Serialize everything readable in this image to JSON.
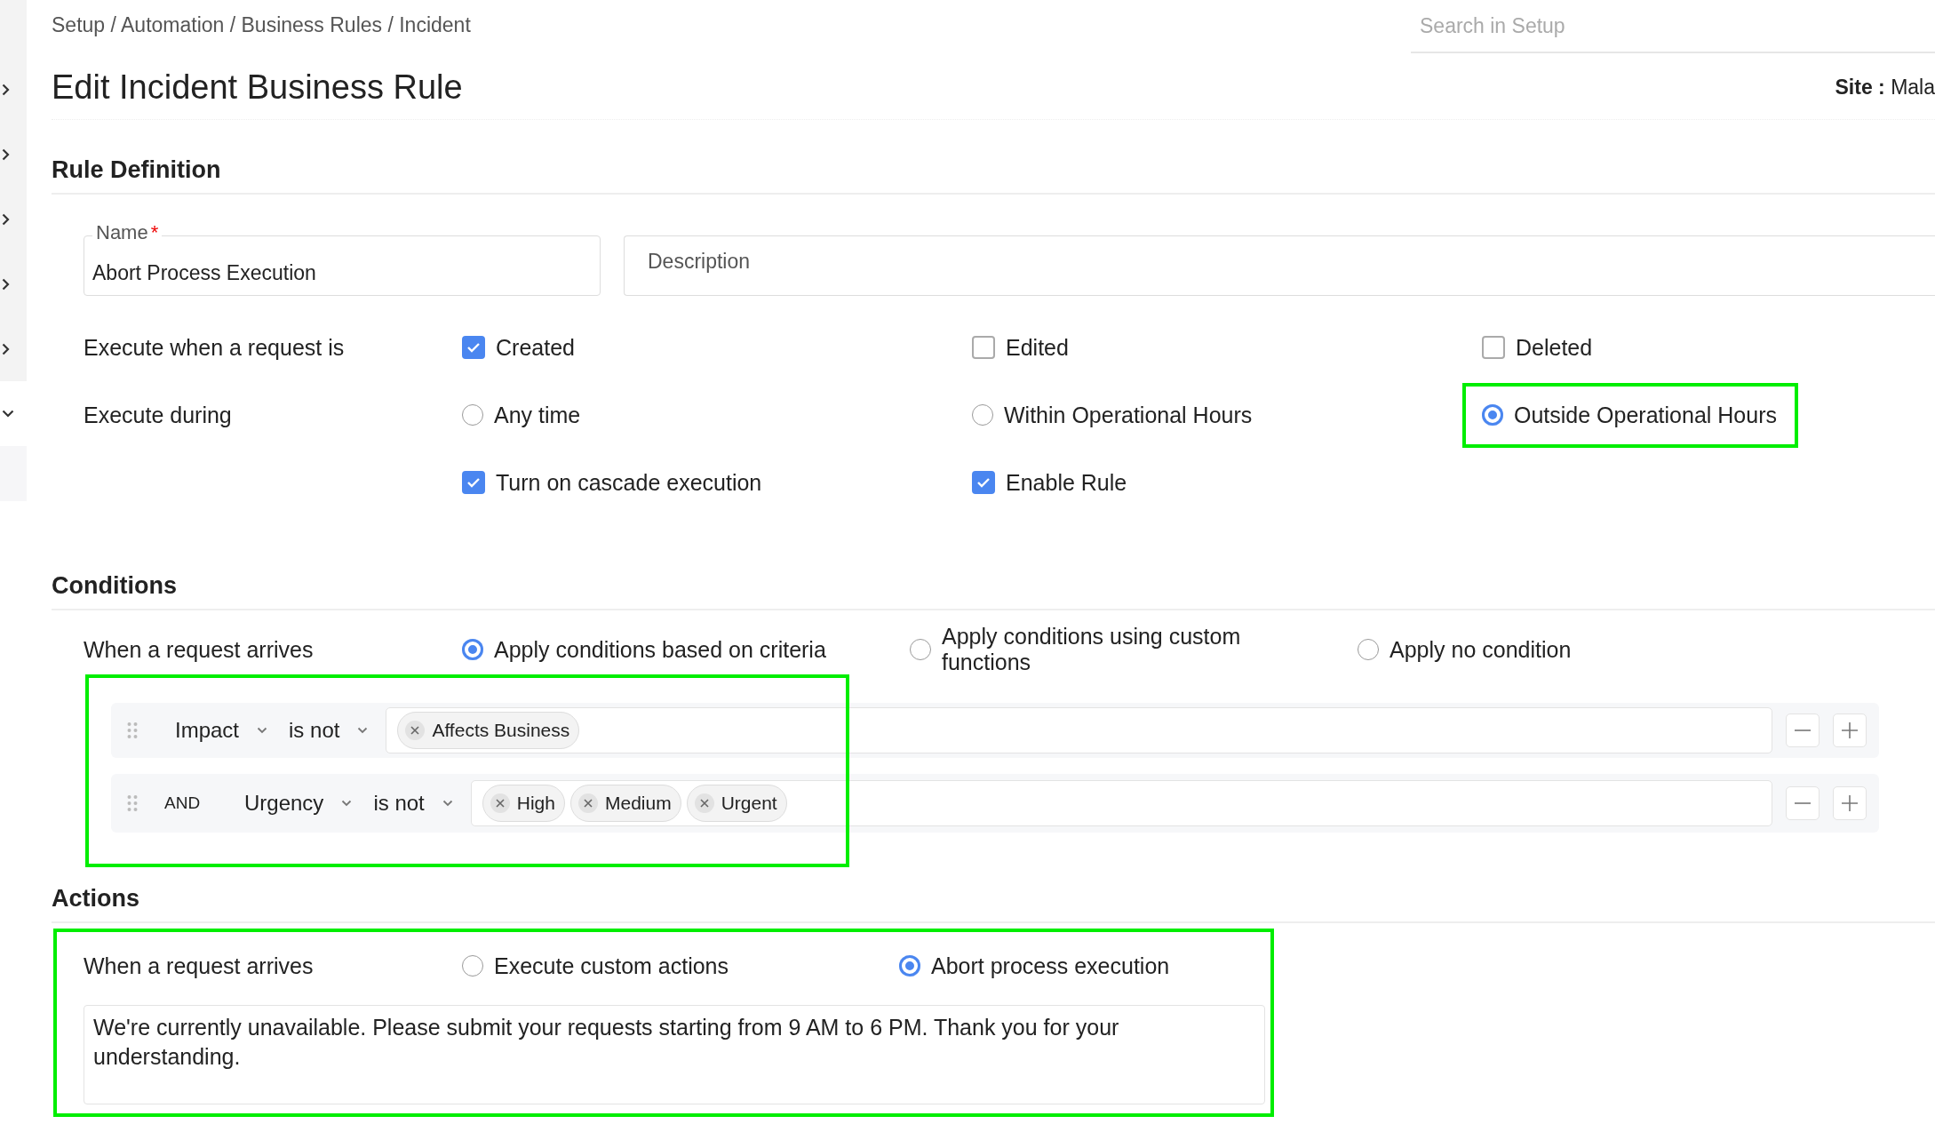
{
  "sidebar": {
    "items": [
      {
        "expanded": false
      },
      {
        "expanded": false
      },
      {
        "expanded": false
      },
      {
        "expanded": false
      },
      {
        "expanded": false
      },
      {
        "expanded": true
      }
    ]
  },
  "breadcrumb": "Setup / Automation / Business Rules / Incident",
  "search": {
    "placeholder": "Search in Setup"
  },
  "title": "Edit Incident Business Rule",
  "site": {
    "label": "Site :",
    "value": "Mala"
  },
  "rule_definition": {
    "heading": "Rule Definition",
    "name_field": {
      "label": "Name",
      "required_mark": "*",
      "value": "Abort Process Execution"
    },
    "description_field": {
      "placeholder": "Description"
    },
    "execute_when": {
      "label": "Execute when a request is",
      "options": [
        {
          "label": "Created",
          "checked": true
        },
        {
          "label": "Edited",
          "checked": false
        },
        {
          "label": "Deleted",
          "checked": false
        }
      ]
    },
    "execute_during": {
      "label": "Execute during",
      "options": [
        {
          "label": "Any time",
          "selected": false,
          "highlighted": false
        },
        {
          "label": "Within Operational Hours",
          "selected": false,
          "highlighted": false
        },
        {
          "label": "Outside Operational Hours",
          "selected": true,
          "highlighted": true
        }
      ]
    },
    "extra_options": [
      {
        "label": "Turn on cascade execution",
        "checked": true
      },
      {
        "label": "Enable Rule",
        "checked": true
      }
    ]
  },
  "conditions": {
    "heading": "Conditions",
    "label": "When a request arrives",
    "highlighted": true,
    "modes": [
      {
        "label": "Apply conditions based on criteria",
        "selected": true
      },
      {
        "label": "Apply conditions using custom functions",
        "selected": false
      },
      {
        "label": "Apply no condition",
        "selected": false
      }
    ],
    "rows": [
      {
        "field": "Impact",
        "operator": "is not",
        "values": [
          "Affects Business"
        ]
      },
      {
        "connector": "AND",
        "field": "Urgency",
        "operator": "is not",
        "values": [
          "High",
          "Medium",
          "Urgent"
        ]
      }
    ]
  },
  "actions": {
    "heading": "Actions",
    "label": "When a request arrives",
    "highlighted": true,
    "modes": [
      {
        "label": "Execute custom actions",
        "selected": false
      },
      {
        "label": "Abort process execution",
        "selected": true
      }
    ],
    "message": "We're currently unavailable. Please submit your requests starting from 9 AM to 6 PM. Thank you for your understanding."
  }
}
